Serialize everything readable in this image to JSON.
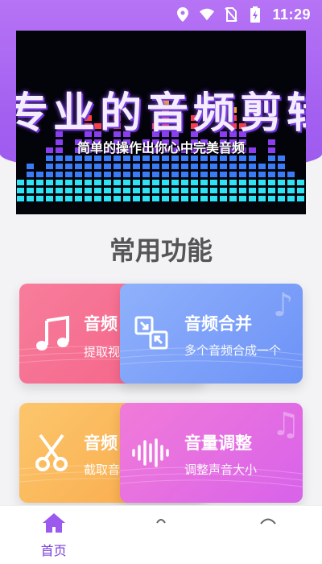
{
  "status_bar": {
    "time": "11:29",
    "icons": [
      "location-icon",
      "wifi-icon",
      "no-sim-icon",
      "battery-icon"
    ]
  },
  "banner": {
    "title": "专业的音频剪辑",
    "subtitle": "简单的操作出你心中完美音频",
    "slides": 3,
    "active_slide": 1
  },
  "section": {
    "title": "常用功能"
  },
  "cards": [
    {
      "title": "音频",
      "desc": "提取视",
      "icon": "music-note-icon",
      "color": "#f56c8e"
    },
    {
      "title": "音频合并",
      "desc": "多个音频合成一个",
      "icon": "merge-icon",
      "color": "#7a9cf8"
    },
    {
      "title": "音频",
      "desc": "截取音",
      "icon": "scissors-icon",
      "color": "#fbb65a"
    },
    {
      "title": "音量调整",
      "desc": "调整声音大小",
      "icon": "waveform-icon",
      "color": "#e06ee2"
    }
  ],
  "bottom_nav": {
    "items": [
      {
        "label": "首页",
        "icon": "home-icon",
        "active": true
      },
      {
        "label": "",
        "icon": "tab2-icon"
      },
      {
        "label": "",
        "icon": "tab3-icon"
      }
    ]
  },
  "colors": {
    "accent": "#9b59ee",
    "header": "#a864f2"
  }
}
